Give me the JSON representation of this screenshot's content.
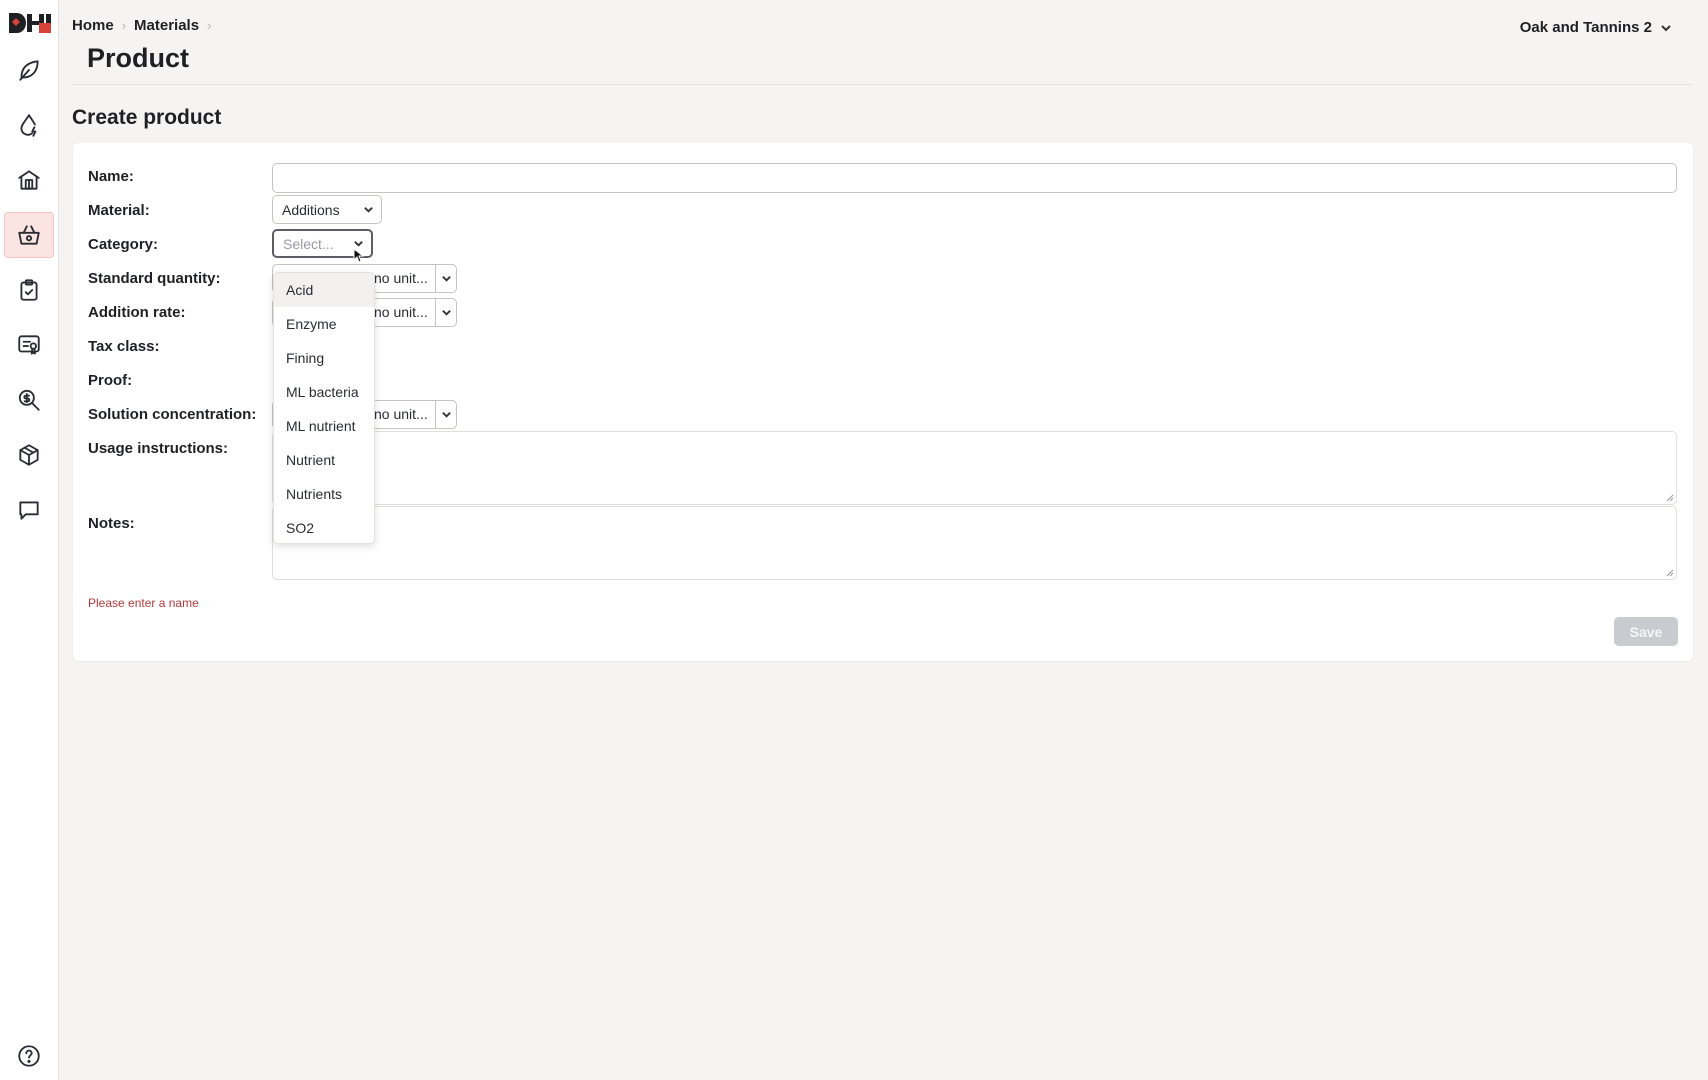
{
  "sidebar": {
    "items": [
      {
        "icon": "leaf-icon",
        "active": false
      },
      {
        "icon": "drop-icon",
        "active": false
      },
      {
        "icon": "winery-icon",
        "active": false
      },
      {
        "icon": "basket-icon",
        "active": true
      },
      {
        "icon": "clipboard-check-icon",
        "active": false
      },
      {
        "icon": "certificate-icon",
        "active": false
      },
      {
        "icon": "dollar-search-icon",
        "active": false
      },
      {
        "icon": "box-icon",
        "active": false
      },
      {
        "icon": "chat-icon",
        "active": false
      }
    ],
    "help_icon": "help-icon"
  },
  "header": {
    "breadcrumb": [
      "Home",
      "Materials"
    ],
    "title": "Product",
    "org": "Oak and Tannins 2"
  },
  "form": {
    "section_title": "Create product",
    "labels": {
      "name": "Name:",
      "material": "Material:",
      "category": "Category:",
      "standard_quantity": "Standard quantity:",
      "addition_rate": "Addition rate:",
      "tax_class": "Tax class:",
      "proof": "Proof:",
      "solution_concentration": "Solution concentration:",
      "usage_instructions": "Usage instructions:",
      "notes": "Notes:"
    },
    "name_value": "",
    "material_value": "Additions",
    "category_placeholder": "Select...",
    "unit_placeholder": "no unit...",
    "error": "Please enter a name",
    "save_label": "Save"
  },
  "category_options": [
    "Acid",
    "Enzyme",
    "Fining",
    "ML bacteria",
    "ML nutrient",
    "Nutrient",
    "Nutrients",
    "SO2"
  ],
  "colors": {
    "accent": "#d6433a",
    "active_nav_bg": "#fbe4e2",
    "error": "#b23a3a",
    "save_disabled": "#c9cbd1"
  }
}
